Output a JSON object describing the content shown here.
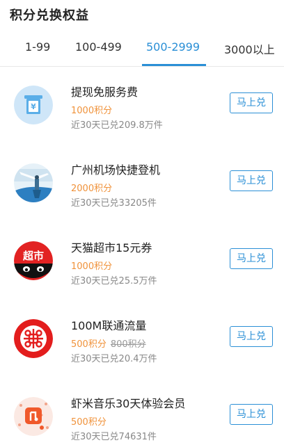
{
  "page": {
    "title": "积分兑换权益"
  },
  "tabs": [
    {
      "label": "1-99"
    },
    {
      "label": "100-499"
    },
    {
      "label": "500-2999"
    },
    {
      "label": "3000以上"
    }
  ],
  "active_tab": "500-2999",
  "colors": {
    "accent": "#2a8fd6",
    "points": "#f0923a",
    "muted": "#888888"
  },
  "items": [
    {
      "title": "提现免服务费",
      "points": "1000积分",
      "original_points": "",
      "sold": "近30天已兑209.8万件",
      "button": "马上兑",
      "icon": "atm-icon"
    },
    {
      "title": "广州机场快捷登机",
      "points": "2000积分",
      "original_points": "",
      "sold": "近30天已兑33205件",
      "button": "马上兑",
      "icon": "airport-icon"
    },
    {
      "title": "天猫超市15元券",
      "points": "1000积分",
      "original_points": "",
      "sold": "近30天已兑25.5万件",
      "button": "马上兑",
      "icon": "tmall-supermarket-logo",
      "icon_text": "超市"
    },
    {
      "title": "100M联通流量",
      "points": "500积分",
      "original_points": "800积分",
      "sold": "近30天已兑20.4万件",
      "button": "马上兑",
      "icon": "china-unicom-logo"
    },
    {
      "title": "虾米音乐30天体验会员",
      "points": "500积分",
      "original_points": "",
      "sold": "近30天已兑74631件",
      "button": "马上兑",
      "icon": "xiami-music-logo"
    }
  ]
}
